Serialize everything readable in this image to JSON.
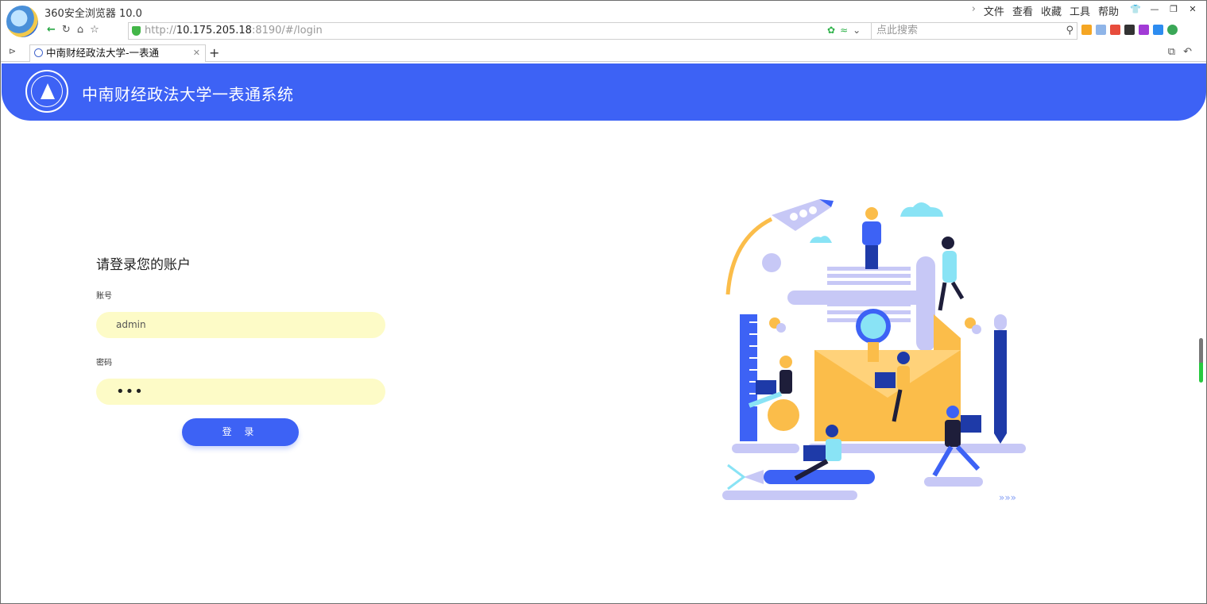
{
  "browser": {
    "app_title": "360安全浏览器 10.0",
    "menu": [
      "文件",
      "查看",
      "收藏",
      "工具",
      "帮助"
    ],
    "url_scheme": "http://",
    "url_host": "10.175.205.18",
    "url_rest": ":8190/#/login",
    "search_placeholder": "点此搜索",
    "tab_title": "中南财经政法大学-一表通",
    "new_tab": "+"
  },
  "header": {
    "title": "中南财经政法大学一表通系统"
  },
  "login": {
    "heading": "请登录您的账户",
    "account_label": "账号",
    "account_value": "admin",
    "password_label": "密码",
    "password_value": "•••",
    "submit_label": "登 录"
  },
  "colors": {
    "primary": "#3d62f5",
    "input_bg": "#fdfbc7",
    "illus_yellow": "#fbbd4a",
    "illus_lavender": "#c7c8f6",
    "illus_navy": "#1e3aa8"
  }
}
